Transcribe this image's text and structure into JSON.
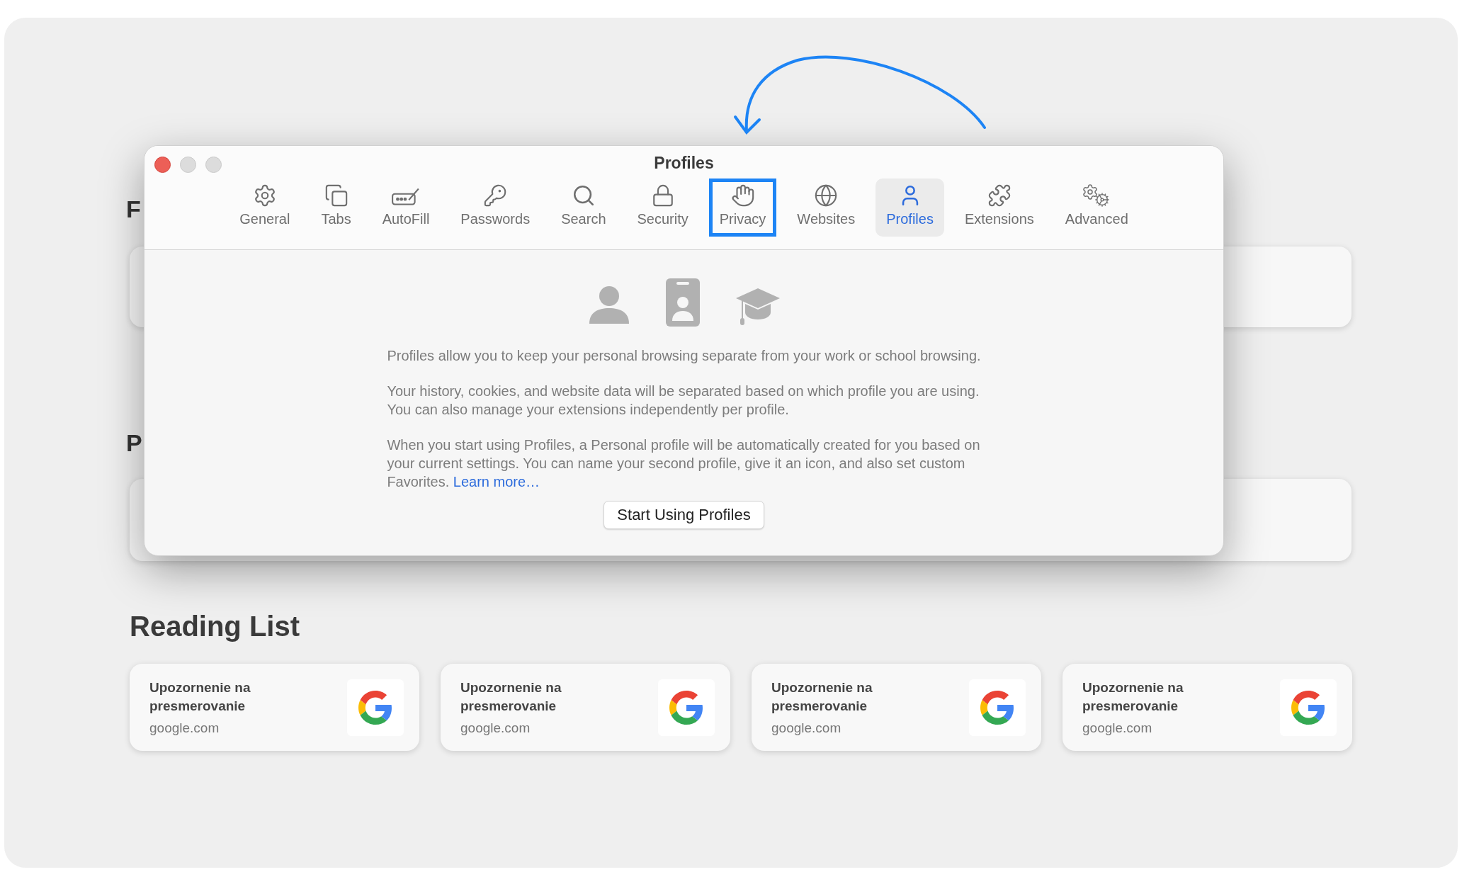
{
  "background": {
    "section_headings": [
      "F",
      "P"
    ],
    "reading_list": {
      "title": "Reading List",
      "items": [
        {
          "title": "Upozornenie na presmerovanie",
          "domain": "google.com"
        },
        {
          "title": "Upozornenie na presmerovanie",
          "domain": "google.com"
        },
        {
          "title": "Upozornenie na presmerovanie",
          "domain": "google.com"
        },
        {
          "title": "Upozornenie na presmerovanie",
          "domain": "google.com"
        }
      ]
    }
  },
  "window": {
    "title": "Profiles",
    "toolbar": [
      {
        "label": "General",
        "selected": false,
        "highlighted": false
      },
      {
        "label": "Tabs",
        "selected": false,
        "highlighted": false
      },
      {
        "label": "AutoFill",
        "selected": false,
        "highlighted": false
      },
      {
        "label": "Passwords",
        "selected": false,
        "highlighted": false
      },
      {
        "label": "Search",
        "selected": false,
        "highlighted": false
      },
      {
        "label": "Security",
        "selected": false,
        "highlighted": false
      },
      {
        "label": "Privacy",
        "selected": false,
        "highlighted": true
      },
      {
        "label": "Websites",
        "selected": false,
        "highlighted": false
      },
      {
        "label": "Profiles",
        "selected": true,
        "highlighted": false
      },
      {
        "label": "Extensions",
        "selected": false,
        "highlighted": false
      },
      {
        "label": "Advanced",
        "selected": false,
        "highlighted": false
      }
    ],
    "paragraphs": [
      [
        "Profiles allow you to keep your personal browsing separate from your work or school browsing."
      ],
      [
        "Your history, cookies, and website data will be separated based on which profile you are using.",
        "You can also manage your extensions independently per profile."
      ],
      [
        "When you start using Profiles, a Personal profile will be automatically created for you based on",
        "your current settings. You can name your second profile, give it an icon, and also set custom",
        "Favorites."
      ]
    ],
    "learn_more_link": "Learn more…",
    "start_button": "Start Using Profiles"
  }
}
